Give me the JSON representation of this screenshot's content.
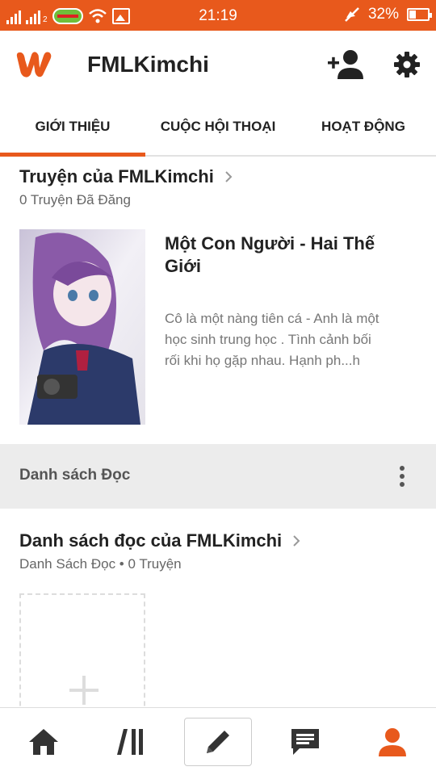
{
  "status_bar": {
    "network_tag": "2",
    "time": "21:19",
    "battery": "32%",
    "battery_level": 0.32,
    "icons": [
      "signal-icon",
      "signal-icon",
      "carrier-icon",
      "wifi-icon",
      "image-icon",
      "mute-icon",
      "battery-icon"
    ]
  },
  "app_bar": {
    "title": "FMLKimchi",
    "icons": [
      "wattpad-logo-icon",
      "add-user-icon",
      "gear-icon"
    ]
  },
  "tabs": [
    {
      "label": "GIỚI THIỆU",
      "active": true
    },
    {
      "label": "CUỘC HỘI THOẠI",
      "active": false
    },
    {
      "label": "HOẠT ĐỘNG",
      "active": false
    }
  ],
  "stories": {
    "title": "Truyện của FMLKimchi",
    "subtitle": "0 Truyện Đã Đăng",
    "story": {
      "title": "Một Con Người - Hai Thế Giới",
      "description": "Cô là một nàng tiên cá - Anh là một học sinh trung học . Tình cảnh bối rối khi họ gặp nhau. Hạnh ph...h"
    }
  },
  "reading_bar": {
    "label": "Danh sách Đọc"
  },
  "reading_lists": {
    "title": "Danh sách đọc của FMLKimchi",
    "subtitle": "Danh Sách Đọc • 0 Truyện"
  },
  "bottom_nav": {
    "items": [
      "home-icon",
      "library-icon",
      "pencil-icon",
      "messages-icon",
      "profile-icon"
    ],
    "active": "profile-icon"
  },
  "colors": {
    "accent": "#e8591c",
    "grey_bar": "#ececec",
    "icon_dark": "#333333"
  }
}
